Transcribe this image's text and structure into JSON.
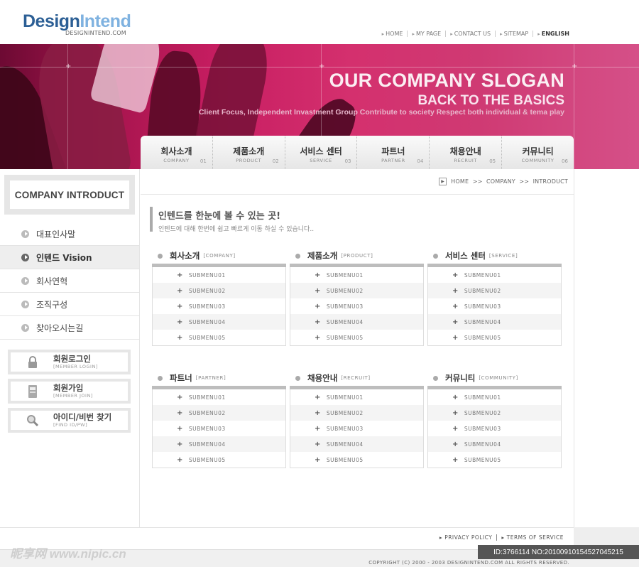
{
  "header": {
    "logo_part1": "Design",
    "logo_part2": "Intend",
    "logo_sub": "DESIGNINTEND.COM",
    "top_links": [
      "HOME",
      "MY PAGE",
      "CONTACT US",
      "SITEMAP",
      "ENGLISH"
    ]
  },
  "banner": {
    "slogan": "OUR COMPANY SLOGAN",
    "tagline": "BACK TO THE BASICS",
    "description": "Client Focus, Independent Invastment Group Contribute to society Respect both individual & tema play"
  },
  "main_nav": [
    {
      "ko": "회사소개",
      "en": "COMPANY",
      "num": "01"
    },
    {
      "ko": "제품소개",
      "en": "PRODUCT",
      "num": "02"
    },
    {
      "ko": "서비스 센터",
      "en": "SERVICE",
      "num": "03"
    },
    {
      "ko": "파트너",
      "en": "PARTNER",
      "num": "04"
    },
    {
      "ko": "채용안내",
      "en": "RECRUIT",
      "num": "05"
    },
    {
      "ko": "커뮤니티",
      "en": "COMMUNITY",
      "num": "06"
    }
  ],
  "sidebar": {
    "title": "COMPANY INTRODUCT",
    "items": [
      "대표인사말",
      "인텐드 Vision",
      "회사연혁",
      "조직구성",
      "찾아오시는길"
    ],
    "active_index": 1,
    "member_buttons": [
      {
        "ko": "회원로그인",
        "en": "[MEMBER LOGIN]",
        "icon": "lock-icon"
      },
      {
        "ko": "회원가입",
        "en": "[MEMBER JOIN]",
        "icon": "member-card-icon"
      },
      {
        "ko": "아이디/비번 찾기",
        "en": "[FIND ID/PW]",
        "icon": "magnifier-icon"
      }
    ]
  },
  "breadcrumb": {
    "path": "HOME  >>  COMPANY  >>  INTRODUCT"
  },
  "intro": {
    "heading": "인텐드를 한눈에 볼 수 있는 곳!",
    "subtext": "인텐드에 대해 한번에 쉽고 빠르게 이동 하실 수 있습니다.."
  },
  "sections": [
    {
      "ko": "회사소개",
      "en": "[COMPANY]",
      "items": [
        "SUBMENU01",
        "SUBMENU02",
        "SUBMENU03",
        "SUBMENU04",
        "SUBMENU05"
      ]
    },
    {
      "ko": "제품소개",
      "en": "[PRODUCT]",
      "items": [
        "SUBMENU01",
        "SUBMENU02",
        "SUBMENU03",
        "SUBMENU04",
        "SUBMENU05"
      ]
    },
    {
      "ko": "서비스 센터",
      "en": "[SERVICE]",
      "items": [
        "SUBMENU01",
        "SUBMENU02",
        "SUBMENU03",
        "SUBMENU04",
        "SUBMENU05"
      ]
    },
    {
      "ko": "파트너",
      "en": "[PARTNER]",
      "items": [
        "SUBMENU01",
        "SUBMENU02",
        "SUBMENU03",
        "SUBMENU04",
        "SUBMENU05"
      ]
    },
    {
      "ko": "채용안내",
      "en": "[RECRUIT]",
      "items": [
        "SUBMENU01",
        "SUBMENU02",
        "SUBMENU03",
        "SUBMENU04",
        "SUBMENU05"
      ]
    },
    {
      "ko": "커뮤니티",
      "en": "[COMMUNITY]",
      "items": [
        "SUBMENU01",
        "SUBMENU02",
        "SUBMENU03",
        "SUBMENU04",
        "SUBMENU05"
      ]
    }
  ],
  "footer": {
    "links": [
      "PRIVACY POLICY",
      "TERMS OF SERVICE"
    ],
    "copyright": "COPYRIGHT (C) 2000 - 2003 DESIGNINTEND.COM  ALL RIGHTS RESERVED."
  },
  "overlay": {
    "watermark": "昵享网 www.nipic.cn",
    "id_text": "ID:3766114 NO:20100910154527045215"
  },
  "colors": {
    "banner_pink": "#c81e62",
    "logo_dark": "#2c5f95",
    "logo_light": "#7fb2e0"
  }
}
